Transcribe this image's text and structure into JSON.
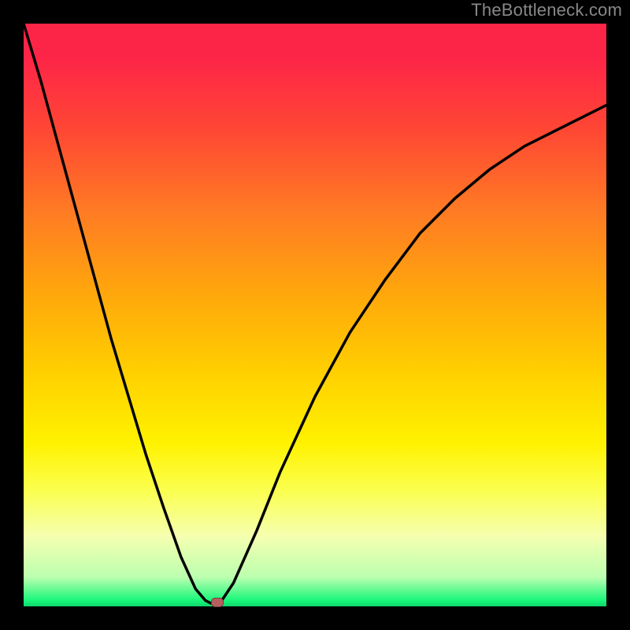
{
  "watermark": "TheBottleneck.com",
  "chart_data": {
    "type": "line",
    "title": "",
    "xlabel": "",
    "ylabel": "",
    "x_range": [
      0,
      1
    ],
    "y_range": [
      0,
      1
    ],
    "series": [
      {
        "name": "bottleneck-curve",
        "x": [
          0.0,
          0.03,
          0.06,
          0.09,
          0.12,
          0.15,
          0.18,
          0.21,
          0.24,
          0.27,
          0.295,
          0.312,
          0.322,
          0.33,
          0.34,
          0.36,
          0.4,
          0.44,
          0.5,
          0.56,
          0.62,
          0.68,
          0.74,
          0.8,
          0.86,
          0.92,
          0.97,
          1.0
        ],
        "y": [
          1.0,
          0.9,
          0.79,
          0.68,
          0.57,
          0.46,
          0.36,
          0.26,
          0.17,
          0.085,
          0.03,
          0.01,
          0.005,
          0.005,
          0.01,
          0.04,
          0.13,
          0.23,
          0.36,
          0.47,
          0.56,
          0.64,
          0.7,
          0.75,
          0.79,
          0.82,
          0.845,
          0.86
        ]
      }
    ],
    "marker": {
      "x": 0.332,
      "y": 0.007
    },
    "gradient_stops": [
      {
        "pos": 0.0,
        "color": "#fd2547"
      },
      {
        "pos": 0.5,
        "color": "#ffd000"
      },
      {
        "pos": 0.8,
        "color": "#fbff4e"
      },
      {
        "pos": 1.0,
        "color": "#0dd66a"
      }
    ]
  }
}
